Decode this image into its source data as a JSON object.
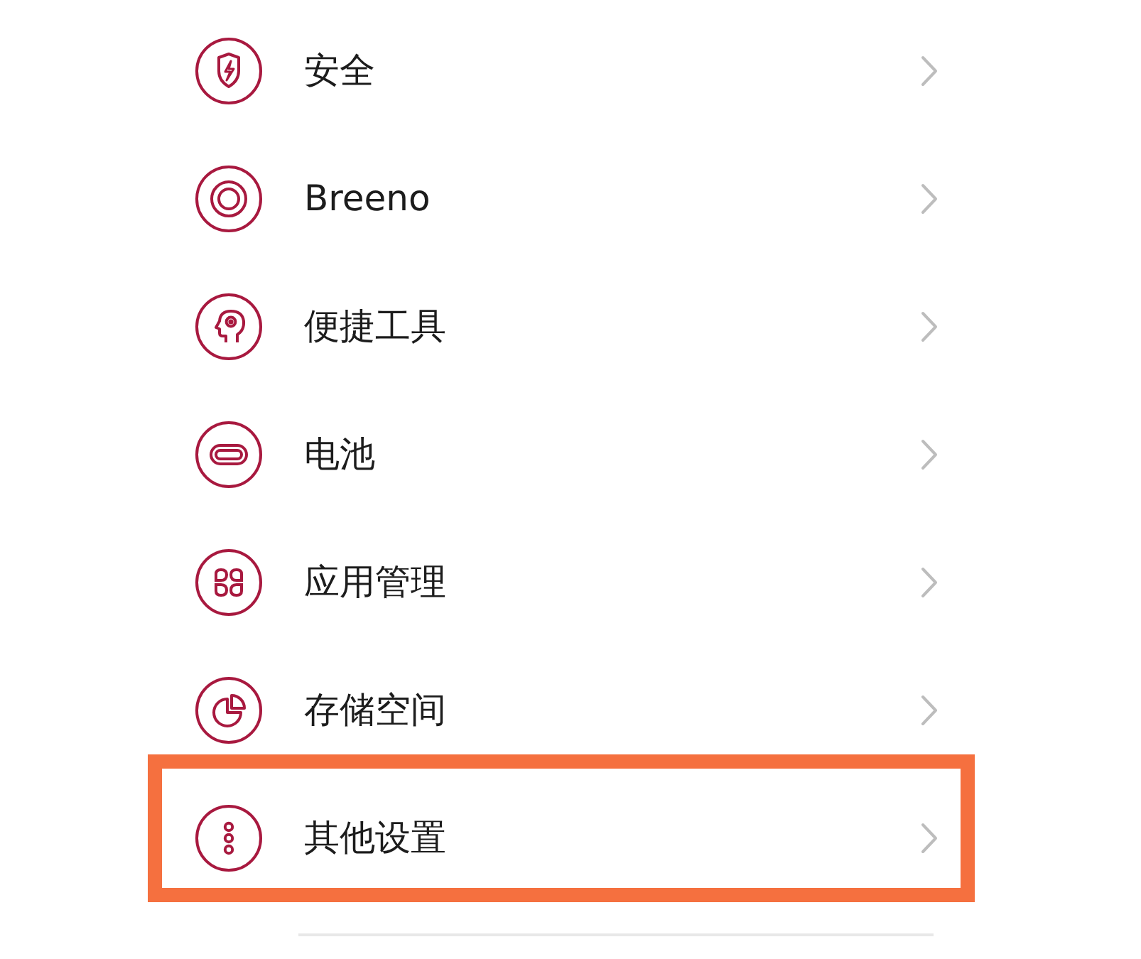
{
  "items": [
    {
      "label": "安全",
      "highlighted": false
    },
    {
      "label": "Breeno",
      "highlighted": false
    },
    {
      "label": "便捷工具",
      "highlighted": false
    },
    {
      "label": "电池",
      "highlighted": false
    },
    {
      "label": "应用管理",
      "highlighted": false
    },
    {
      "label": "存储空间",
      "highlighted": false
    },
    {
      "label": "其他设置",
      "highlighted": true
    }
  ]
}
